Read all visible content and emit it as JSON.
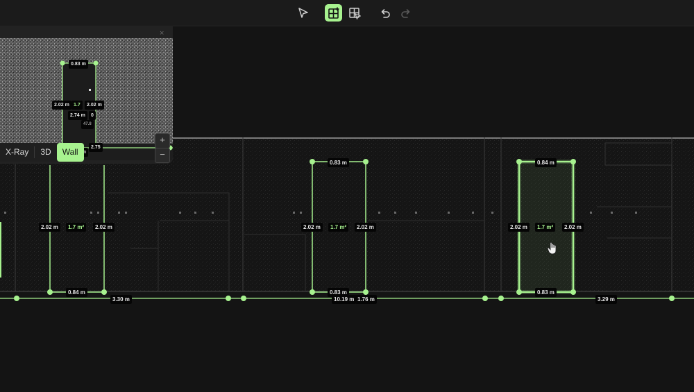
{
  "toolbar": {
    "tools": [
      {
        "name": "select-tool",
        "icon": "pointer-arrow-icon",
        "active": false
      },
      {
        "name": "grid-add-tool",
        "icon": "grid-plus-icon",
        "active": true
      },
      {
        "name": "opening-tool",
        "icon": "grid-cursor-icon",
        "active": false
      },
      {
        "name": "undo",
        "icon": "undo-icon",
        "active": false
      },
      {
        "name": "redo",
        "icon": "redo-icon",
        "active": false
      }
    ]
  },
  "accent_color": "#a7f28f",
  "minimap": {
    "close_label": "×",
    "zoom_in_label": "+",
    "zoom_out_label": "−",
    "labels": {
      "top_width": "0.83 m",
      "left_height": "2.02 m",
      "area": "1.7",
      "right_height": "2.02 m",
      "inner_height": "2.74 m",
      "partial_a": "0",
      "partial_b": "47.8",
      "bottom_partial": "19 m",
      "bottom_partial_b": "2.75"
    }
  },
  "view_modes": {
    "items": [
      "X-Ray",
      "3D",
      "Wall"
    ],
    "active": "Wall"
  },
  "openings": [
    {
      "top": "",
      "left": "2.02 m",
      "area": "1.7 m²",
      "right": "2.02 m",
      "bottom": "0.84 m"
    },
    {
      "top": "0.83 m",
      "left": "2.02 m",
      "area": "1.7 m²",
      "right": "2.02 m",
      "bottom": "0.83 m"
    },
    {
      "top": "0.84 m",
      "left": "2.02 m",
      "area": "1.7 m²",
      "right": "2.02 m",
      "bottom": "0.83 m"
    }
  ],
  "wall_segments": [
    "3.30 m",
    "10.19 m",
    "1.76 m",
    "3.29 m"
  ]
}
